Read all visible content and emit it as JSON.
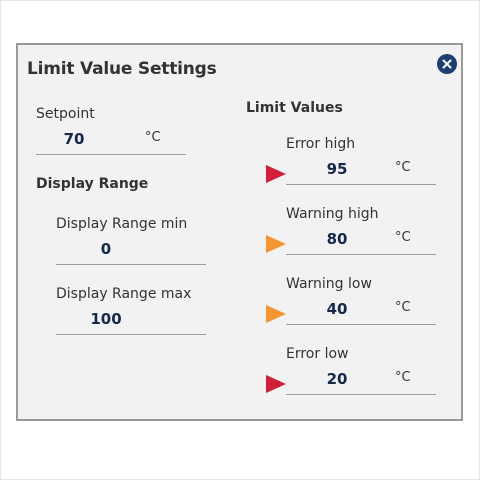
{
  "dialog": {
    "title": "Limit Value Settings",
    "close_icon": "close-icon"
  },
  "setpoint": {
    "label": "Setpoint",
    "value": "70",
    "unit": "°C"
  },
  "display_range": {
    "heading": "Display Range",
    "min": {
      "label": "Display Range min",
      "value": "0"
    },
    "max": {
      "label": "Display Range max",
      "value": "100"
    }
  },
  "limit_values": {
    "heading": "Limit Values",
    "error_high": {
      "label": "Error high",
      "value": "95",
      "unit": "°C",
      "marker_color": "#d41d36",
      "icon": "error-marker-icon"
    },
    "warning_high": {
      "label": "Warning high",
      "value": "80",
      "unit": "°C",
      "marker_color": "#f5952f",
      "icon": "warning-marker-icon"
    },
    "warning_low": {
      "label": "Warning low",
      "value": "40",
      "unit": "°C",
      "marker_color": "#f5952f",
      "icon": "warning-marker-icon"
    },
    "error_low": {
      "label": "Error low",
      "value": "20",
      "unit": "°C",
      "marker_color": "#d41d36",
      "icon": "error-marker-icon"
    }
  },
  "colors": {
    "accent": "#1f3e73",
    "value_text": "#14284b",
    "error": "#d41d36",
    "warning": "#f5952f",
    "panel_bg": "#f2f2f2"
  }
}
